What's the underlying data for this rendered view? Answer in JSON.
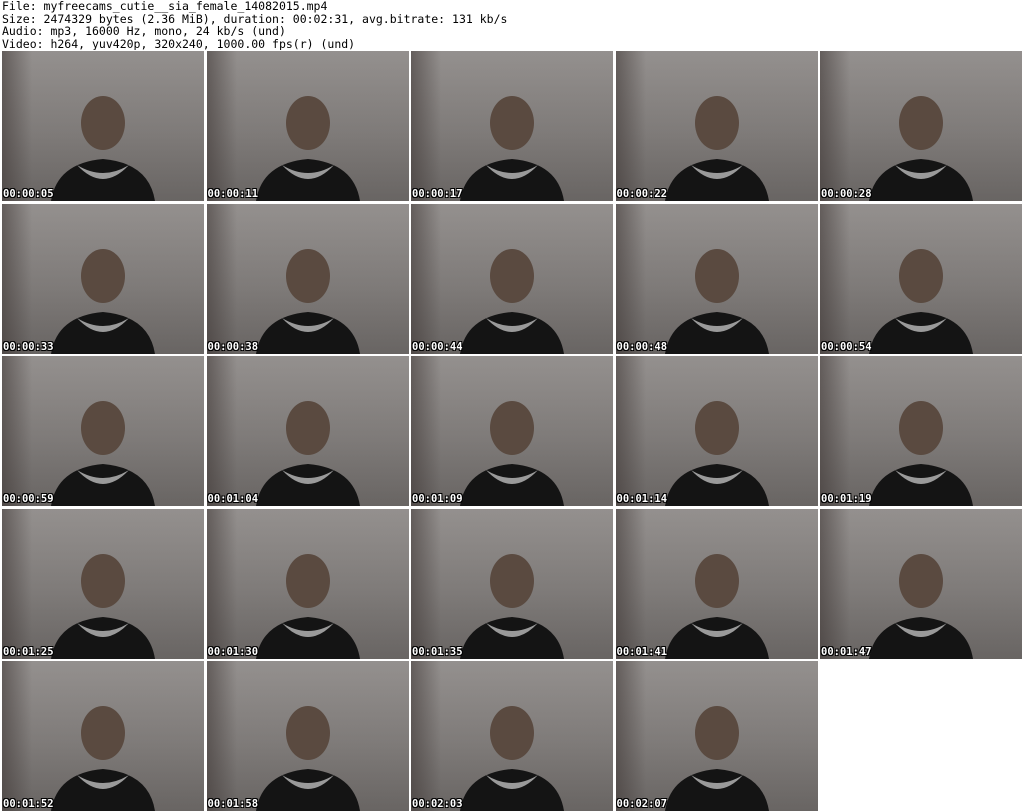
{
  "header": {
    "file_line": "File: myfreecams_cutie__sia_female_14082015.mp4",
    "size_line": "Size: 2474329 bytes (2.36 MiB), duration: 00:02:31, avg.bitrate: 131 kb/s",
    "audio_line": "Audio: mp3, 16000 Hz, mono, 24 kb/s (und)",
    "video_line": "Video: h264, yuv420p, 320x240, 1000.00 fps(r) (und)"
  },
  "frames": [
    {
      "timestamp": "00:00:05"
    },
    {
      "timestamp": "00:00:11"
    },
    {
      "timestamp": "00:00:17"
    },
    {
      "timestamp": "00:00:22"
    },
    {
      "timestamp": "00:00:28"
    },
    {
      "timestamp": "00:00:33"
    },
    {
      "timestamp": "00:00:38"
    },
    {
      "timestamp": "00:00:44"
    },
    {
      "timestamp": "00:00:48"
    },
    {
      "timestamp": "00:00:54"
    },
    {
      "timestamp": "00:00:59"
    },
    {
      "timestamp": "00:01:04"
    },
    {
      "timestamp": "00:01:09"
    },
    {
      "timestamp": "00:01:14"
    },
    {
      "timestamp": "00:01:19"
    },
    {
      "timestamp": "00:01:25"
    },
    {
      "timestamp": "00:01:30"
    },
    {
      "timestamp": "00:01:35"
    },
    {
      "timestamp": "00:01:41"
    },
    {
      "timestamp": "00:01:47"
    },
    {
      "timestamp": "00:01:52"
    },
    {
      "timestamp": "00:01:58"
    },
    {
      "timestamp": "00:02:03"
    },
    {
      "timestamp": "00:02:07"
    }
  ],
  "colors": {
    "background": "#ffffff",
    "text": "#000000",
    "timestamp_text": "#ffffff",
    "timestamp_outline": "#000000"
  }
}
